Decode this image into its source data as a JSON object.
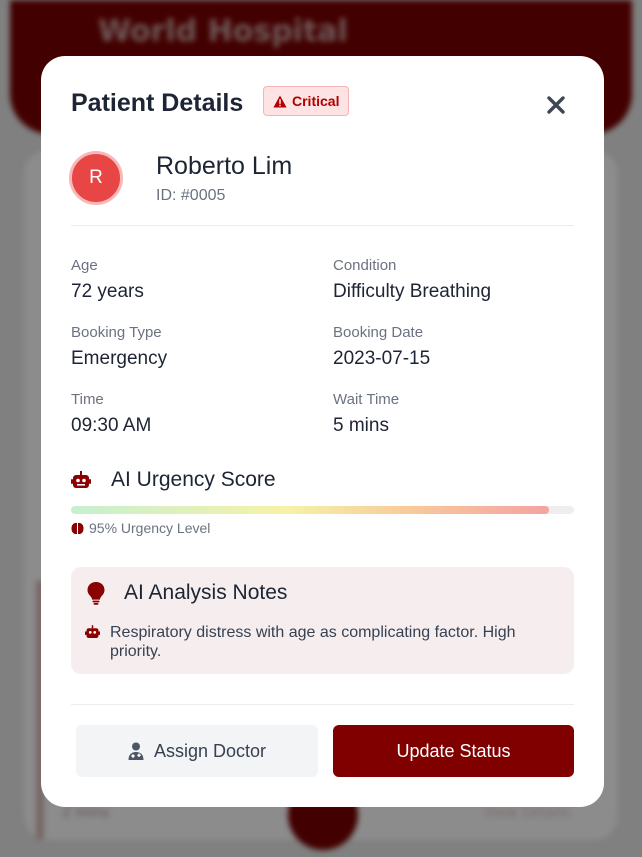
{
  "background": {
    "app_title": "World Hospital",
    "left_text": "2 mins",
    "right_text": "View Details"
  },
  "modal": {
    "title": "Patient Details",
    "badge": {
      "label": "Critical",
      "icon": "warning-triangle-icon",
      "color": "#b00000"
    },
    "close_icon": "close-icon"
  },
  "patient": {
    "initial": "R",
    "name": "Roberto Lim",
    "id": "ID: #0005"
  },
  "details": {
    "age_label": "Age",
    "age_value": "72 years",
    "condition_label": "Condition",
    "condition_value": "Difficulty Breathing",
    "booking_type_label": "Booking Type",
    "booking_type_value": "Emergency",
    "booking_date_label": "Booking Date",
    "booking_date_value": "2023-07-15",
    "time_label": "Time",
    "time_value": "09:30 AM",
    "wait_time_label": "Wait Time",
    "wait_time_value": "5 mins"
  },
  "ai_urgency": {
    "title": "AI Urgency Score",
    "icon": "robot-icon",
    "percent": 95,
    "level_text": "95% Urgency Level",
    "level_icon": "brain-icon"
  },
  "ai_notes": {
    "title": "AI Analysis Notes",
    "icon": "lightbulb-icon",
    "items": [
      {
        "icon": "robot-icon",
        "text": "Respiratory distress with age as complicating factor. High priority."
      }
    ]
  },
  "actions": {
    "assign_label": "Assign Doctor",
    "assign_icon": "doctor-icon",
    "update_label": "Update Status"
  },
  "colors": {
    "brand": "#800000",
    "avatar": "#e84545",
    "notes_background": "#f6eeee"
  }
}
